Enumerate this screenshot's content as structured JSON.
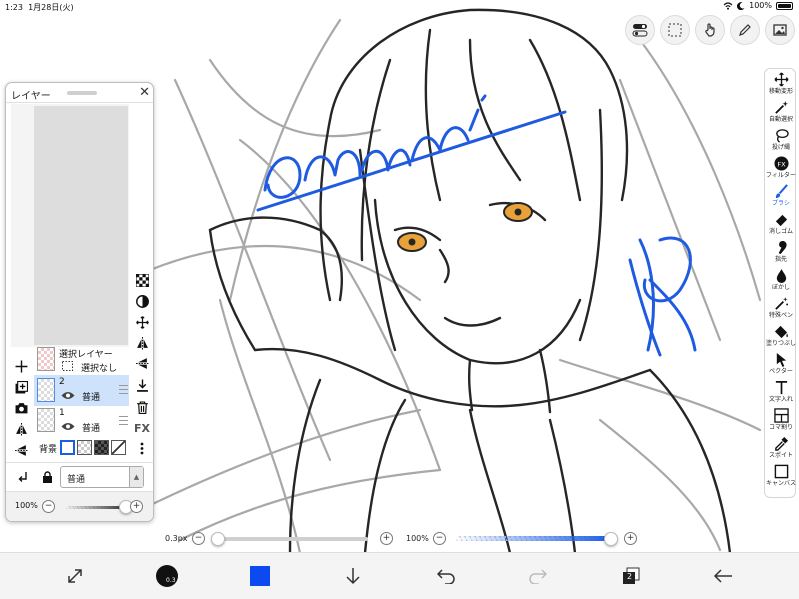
{
  "status_bar": {
    "time": "1:23",
    "date": "1月28日(火)",
    "battery": "100%"
  },
  "right_tools": [
    {
      "label": "移動変形",
      "icon": "move-transform-icon"
    },
    {
      "label": "自動選択",
      "icon": "magic-wand-icon"
    },
    {
      "label": "投げ縄",
      "icon": "lasso-icon"
    },
    {
      "label": "フィルター",
      "icon": "filter-fx-icon"
    },
    {
      "label": "ブラシ",
      "icon": "brush-icon",
      "active": true
    },
    {
      "label": "消しゴム",
      "icon": "eraser-icon"
    },
    {
      "label": "指先",
      "icon": "finger-smudge-icon"
    },
    {
      "label": "ぼかし",
      "icon": "blur-icon"
    },
    {
      "label": "特殊ペン",
      "icon": "special-pen-icon"
    },
    {
      "label": "塗りつぶし",
      "icon": "fill-bucket-icon"
    },
    {
      "label": "ベクター",
      "icon": "vector-icon"
    },
    {
      "label": "文字入れ",
      "icon": "text-icon"
    },
    {
      "label": "コマ割り",
      "icon": "frame-divide-icon"
    },
    {
      "label": "スポイト",
      "icon": "eyedropper-icon"
    },
    {
      "label": "キャンバス",
      "icon": "canvas-icon"
    }
  ],
  "layer_panel": {
    "title": "レイヤー",
    "selection_layer": {
      "name": "選択レイヤー",
      "state": "選択なし"
    },
    "layers": [
      {
        "number": "2",
        "mode": "普通",
        "selected": true
      },
      {
        "number": "1",
        "mode": "普通",
        "selected": false
      }
    ],
    "background_label": "背景",
    "fx_label": "FX",
    "blend_mode": "普通",
    "opacity": "100%",
    "opacity_fraction": 1.0
  },
  "bottom_sliders": {
    "brush_size": "0.3px",
    "brush_size_fraction": 0.0,
    "brush_opacity": "100%",
    "brush_opacity_fraction": 1.0
  },
  "bottom_bar": {
    "brush_dot_label": "0.3",
    "layer_count": "2",
    "current_color": "#0a4af0"
  },
  "colors": {
    "accent": "#1a5ee6",
    "stroke_blue": "#1f5be0"
  }
}
